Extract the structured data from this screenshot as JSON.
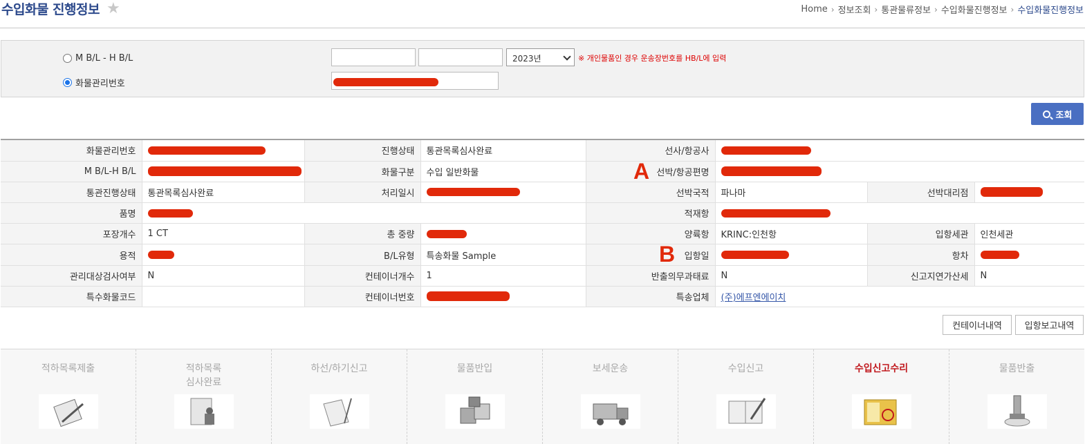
{
  "header": {
    "title": "수입화물 진행정보",
    "star_icon": "star-icon",
    "breadcrumbs": [
      "Home",
      "정보조회",
      "통관물류정보",
      "수입화물진행정보",
      "수입화물진행정보"
    ]
  },
  "search": {
    "options": [
      {
        "label": "M B/L - H B/L",
        "selected": false
      },
      {
        "label": "화물관리번호",
        "selected": true
      }
    ],
    "mbl_value": "",
    "hbl_value": "",
    "year_value": "2023년",
    "notice": "※ 개인물품인 경우 운송장번호를 HB/L에 입력",
    "cargo_no_value": "",
    "search_button": "조회"
  },
  "info": {
    "labels": {
      "cargo_no": "화물관리번호",
      "progress_status": "진행상태",
      "carrier": "선사/항공사",
      "mbl_hbl": "M B/L-H B/L",
      "cargo_type": "화물구분",
      "vessel": "선박/항공편명",
      "clearance_status": "통관진행상태",
      "processed_at": "처리일시",
      "vessel_nationality": "선박국적",
      "vessel_agent": "선박대리점",
      "item_name": "품명",
      "loading_port": "적재항",
      "package_count": "포장개수",
      "gross_weight": "총 중량",
      "unloading_port": "양륙항",
      "entry_customs": "입항세관",
      "volume": "용적",
      "bl_type": "B/L유형",
      "arrival_date": "입항일",
      "voyage": "항차",
      "inspection_target": "관리대상검사여부",
      "container_count": "컨테이너개수",
      "export_duty": "반출의무과태료",
      "late_report_tax": "신고지연가산세",
      "special_cargo_code": "특수화물코드",
      "container_no": "컨테이너번호",
      "courier": "특송업체"
    },
    "values": {
      "progress_status": "통관목록심사완료",
      "cargo_type": "수입 일반화물",
      "clearance_status": "통관목록심사완료",
      "vessel_nationality": "파나마",
      "package_count": "1 CT",
      "unloading_port": "KRINC:인천항",
      "entry_customs": "인천세관",
      "bl_type": "특송화물 Sample",
      "inspection_target": "N",
      "container_count": "1",
      "export_duty": "N",
      "late_report_tax": "N",
      "special_cargo_code": "",
      "courier": "(주)에프엔에이치"
    },
    "markers": {
      "a": "A",
      "b": "B"
    }
  },
  "buttons": {
    "container_details": "컨테이너내역",
    "arrival_report": "입항보고내역"
  },
  "steps": [
    {
      "label": "적하목록제출",
      "icon": "clipboard-pen-icon",
      "active": false
    },
    {
      "label": "적하목록\n심사완료",
      "icon": "document-stamp-icon",
      "active": false
    },
    {
      "label": "하선/하기신고",
      "icon": "book-pen-icon",
      "active": false
    },
    {
      "label": "물품반입",
      "icon": "boxes-icon",
      "active": false
    },
    {
      "label": "보세운송",
      "icon": "truck-icon",
      "active": false
    },
    {
      "label": "수입신고",
      "icon": "open-book-pen-icon",
      "active": false
    },
    {
      "label": "수입신고수리",
      "icon": "approved-document-icon",
      "active": true
    },
    {
      "label": "물품반출",
      "icon": "stamp-icon",
      "active": false
    }
  ],
  "colors": {
    "brand": "#2d4a8c",
    "accent": "#4a6fc2",
    "redaction": "#e1290a",
    "active_step": "#c0181d"
  }
}
